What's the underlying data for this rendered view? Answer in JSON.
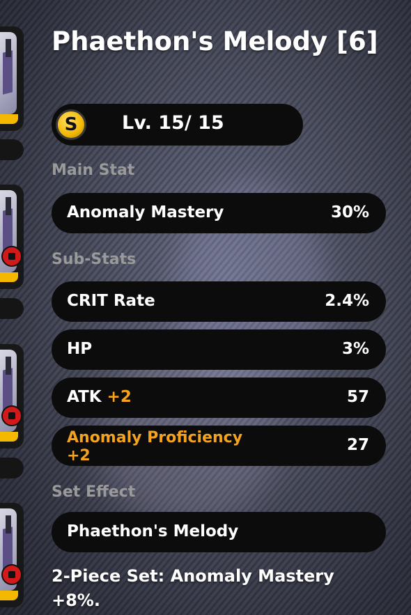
{
  "disc": {
    "title": "Phaethon's Melody [6]",
    "rank_icon": "S",
    "level": "Lv. 15/ 15"
  },
  "main_stat": {
    "label": "Main Stat",
    "name": "Anomaly Mastery",
    "value": "30%"
  },
  "sub_stats": {
    "label": "Sub-Stats",
    "items": [
      {
        "name": "CRIT Rate",
        "plus": "",
        "value": "2.4%"
      },
      {
        "name": "HP",
        "plus": "",
        "value": "3%"
      },
      {
        "name": "ATK",
        "plus": "+2",
        "value": "57"
      },
      {
        "name": "Anomaly Proficiency",
        "plus": "+2",
        "value": "27"
      }
    ]
  },
  "set_effect": {
    "label": "Set Effect",
    "name": "Phaethon's Melody",
    "description": "2-Piece Set: Anomaly Mastery +8%."
  },
  "colors": {
    "accent": "#f5a21c",
    "pill_bg": "#0c0c0c",
    "section_label": "#9a9a9a",
    "slot_bar": "#f5b800",
    "lock": "#d21a1a"
  },
  "icons": [
    "s-rank-coin-icon",
    "disc-slot-icon",
    "lock-icon"
  ]
}
